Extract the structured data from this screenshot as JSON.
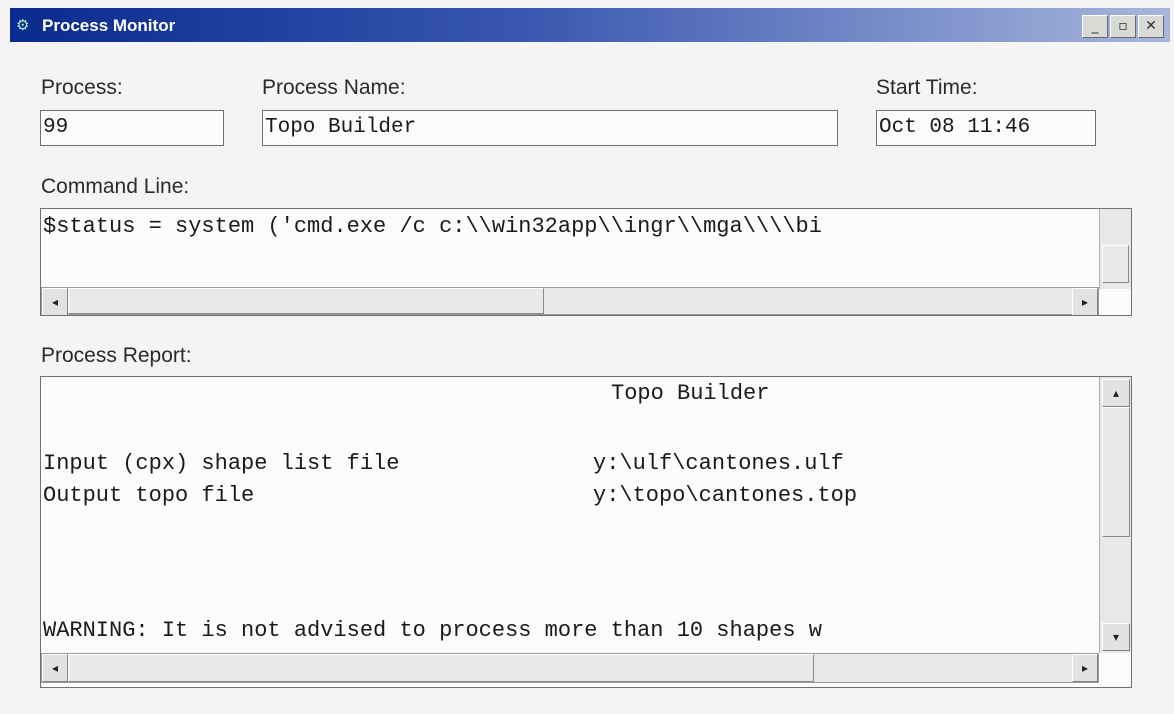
{
  "window": {
    "title": "Process Monitor",
    "icon": "process-monitor-icon",
    "minimize_glyph": "_",
    "restore_glyph": "▫",
    "close_glyph": "✕"
  },
  "fields": {
    "process_label": "Process:",
    "process_value": "99",
    "process_name_label": "Process Name:",
    "process_name_value": "Topo Builder",
    "start_time_label": "Start Time:",
    "start_time_value": "Oct 08 11:46"
  },
  "command": {
    "label": "Command Line:",
    "text": "$status = system ('cmd.exe /c c:\\\\win32app\\\\ingr\\\\mga\\\\\\\\bi"
  },
  "report": {
    "label": "Process Report:",
    "heading": "Topo Builder",
    "lines": [
      {
        "key": "Input (cpx) shape list file",
        "value": "y:\\ulf\\cantones.ulf"
      },
      {
        "key": "Output topo file",
        "value": "y:\\topo\\cantones.top"
      }
    ],
    "warning": "WARNING: It is not advised to process more than 10 shapes w"
  },
  "scroll_glyphs": {
    "left": "◂",
    "right": "▸",
    "up": "▴",
    "down": "▾"
  }
}
